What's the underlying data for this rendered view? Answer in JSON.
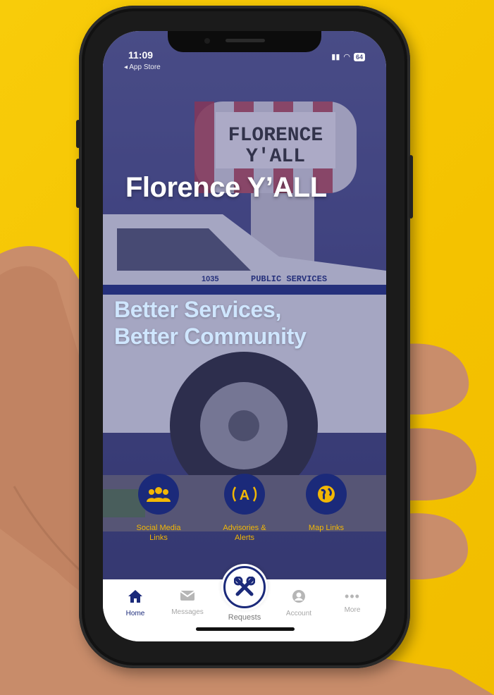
{
  "status_bar": {
    "time": "11:09",
    "back_label": "◂ App Store",
    "battery": "64"
  },
  "app": {
    "title": "Florence Y’ALL",
    "tagline_line1": "Better Services,",
    "tagline_line2": "Better Community"
  },
  "scene": {
    "tower_text_line1": "FLORENCE",
    "tower_text_line2": "Y'ALL",
    "truck_number": "1035",
    "truck_text": "PUBLIC SERVICES"
  },
  "tiles": [
    {
      "label_line1": "Social Media",
      "label_line2": "Links",
      "icon": "users-icon"
    },
    {
      "label_line1": "Advisories &",
      "label_line2": "Alerts",
      "icon": "broadcast-icon"
    },
    {
      "label_line1": "Map Links",
      "label_line2": "",
      "icon": "globe-icon"
    }
  ],
  "tabbar": {
    "home": "Home",
    "messages": "Messages",
    "requests": "Requests",
    "account": "Account",
    "more": "More"
  },
  "colors": {
    "background": "#f6c400",
    "navy": "#1b2a7a",
    "tile_label": "#f2b705",
    "tagline": "#cfe6ff"
  }
}
